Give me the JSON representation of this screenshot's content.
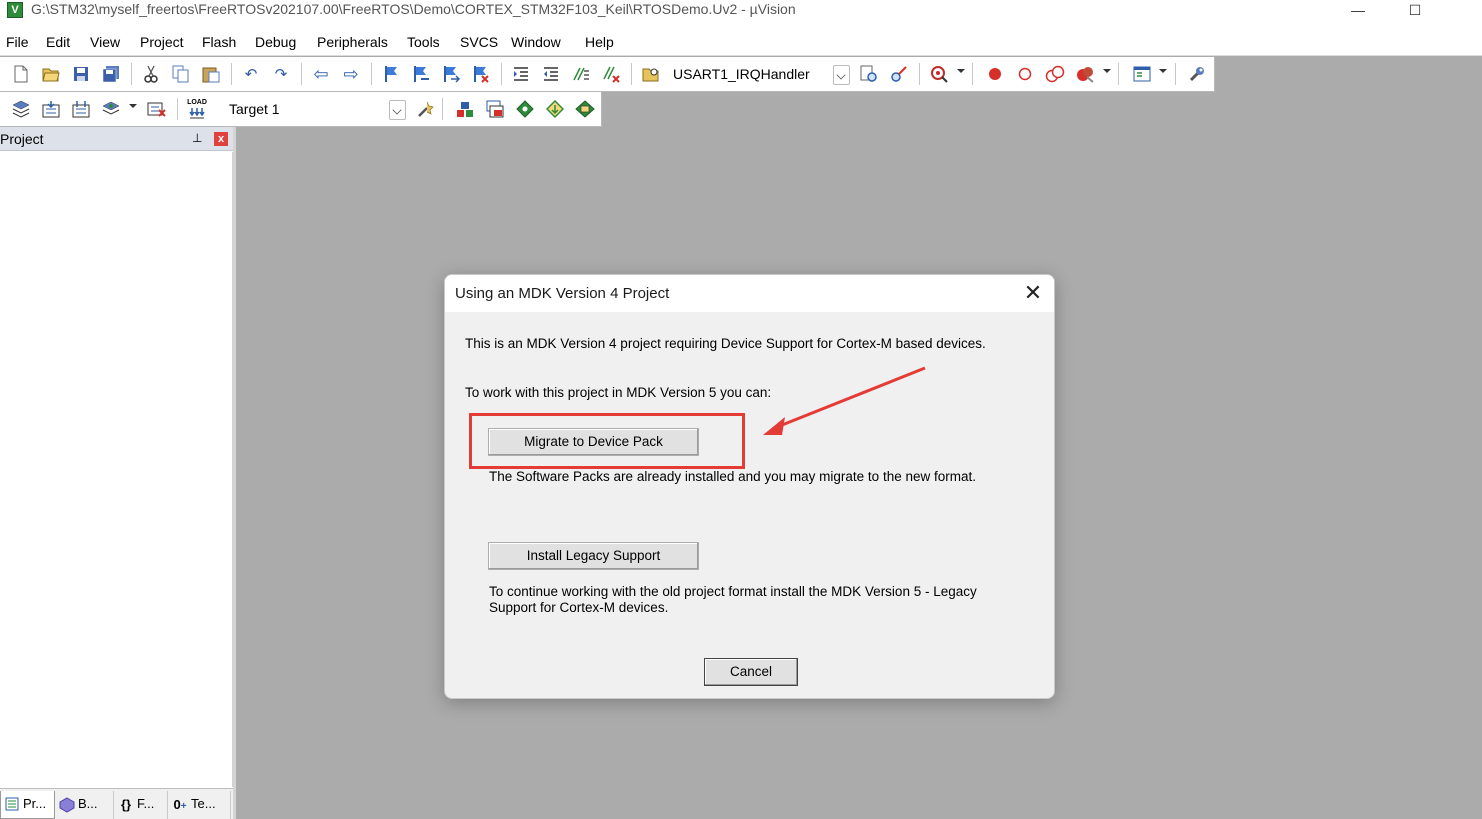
{
  "window": {
    "title": "G:\\STM32\\myself_freertos\\FreeRTOSv202107.00\\FreeRTOS\\Demo\\CORTEX_STM32F103_Keil\\RTOSDemo.Uv2 - µVision",
    "app_icon_letter": "V",
    "minimize_glyph": "—",
    "maximize_glyph": "☐"
  },
  "menu": [
    "File",
    "Edit",
    "View",
    "Project",
    "Flash",
    "Debug",
    "Peripherals",
    "Tools",
    "SVCS",
    "Window",
    "Help"
  ],
  "toolbar1": {
    "function_combo": "USART1_IRQHandler"
  },
  "toolbar2": {
    "load_label": "LOAD",
    "target_combo": "Target 1"
  },
  "project_panel": {
    "title": "Project",
    "pin_glyph": "⊥",
    "close_glyph": "x",
    "tabs": [
      {
        "icon": "project-icon",
        "label": "Pr..."
      },
      {
        "icon": "books-icon",
        "label": "B..."
      },
      {
        "icon": "functions-icon",
        "label": "F..."
      },
      {
        "icon": "templates-icon",
        "label": "Te..."
      }
    ]
  },
  "dialog": {
    "title": "Using an MDK Version 4 Project",
    "close_glyph": "✕",
    "line1": "This is an MDK Version 4 project requiring Device Support for Cortex-M based devices.",
    "line2": "To work with this project in MDK Version 5 you can:",
    "migrate_button": "Migrate to Device Pack",
    "migrate_desc": "The Software Packs are already installed and you may migrate to the new format.",
    "legacy_button": "Install Legacy Support",
    "legacy_desc_1": "To continue working with the old project format install the MDK Version 5 - Legacy",
    "legacy_desc_2": "Support for Cortex-M devices.",
    "cancel_button": "Cancel"
  },
  "annotation": {
    "color": "#e53b36"
  },
  "colors": {
    "workspace_bg": "#ababab",
    "dialog_bg": "#f0f0f0"
  }
}
